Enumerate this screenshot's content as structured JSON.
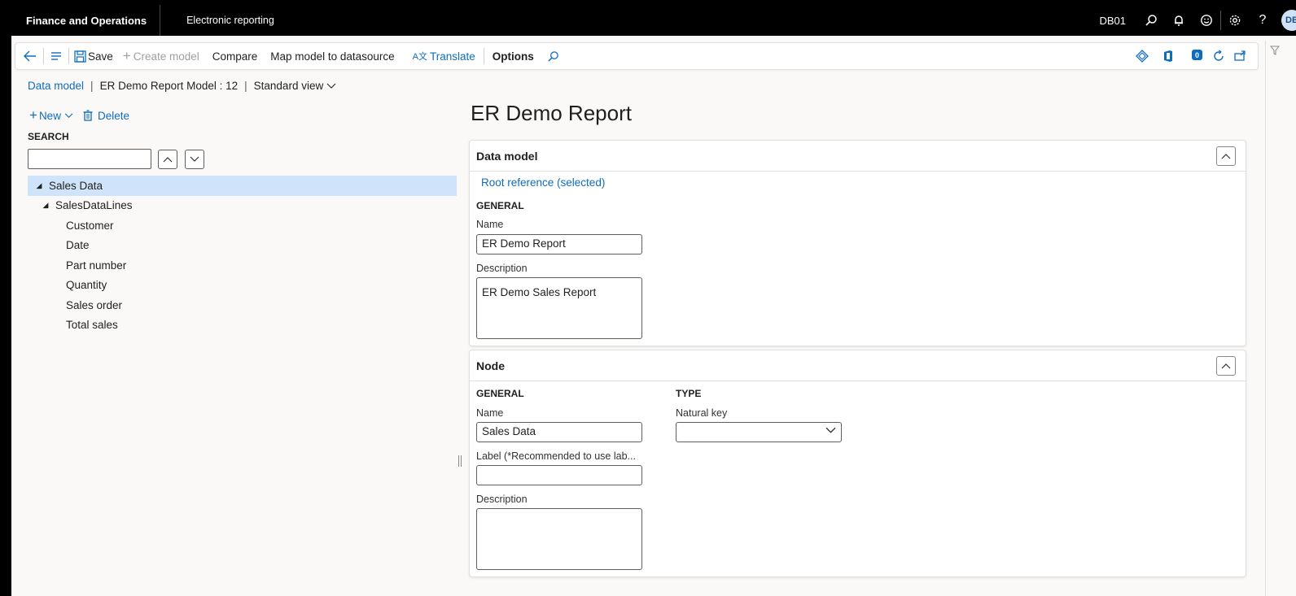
{
  "topbar": {
    "app_title": "Finance and Operations",
    "module_title": "Electronic reporting",
    "company": "DB01",
    "avatar_initials": "DB",
    "icons": [
      "search-icon",
      "bell-icon",
      "smiley-icon",
      "gear-icon",
      "help-icon"
    ]
  },
  "actionpane": {
    "save_label": "Save",
    "create_model_label": "Create model",
    "compare_label": "Compare",
    "map_label": "Map model to datasource",
    "translate_label": "Translate",
    "options_label": "Options",
    "notification_count": "0"
  },
  "breadcrumb": {
    "link": "Data model",
    "model": "ER Demo Report Model : 12",
    "view": "Standard view"
  },
  "left": {
    "new_label": "New",
    "delete_label": "Delete",
    "search_label": "SEARCH",
    "search_value": "",
    "tree": [
      {
        "label": "Sales Data",
        "caret": "◢",
        "indent": 0,
        "selected": true
      },
      {
        "label": "SalesDataLines",
        "caret": "◢",
        "indent": 1
      },
      {
        "label": "Customer",
        "indent": 2
      },
      {
        "label": "Date",
        "indent": 2
      },
      {
        "label": "Part number",
        "indent": 2
      },
      {
        "label": "Quantity",
        "indent": 2
      },
      {
        "label": "Sales order",
        "indent": 2
      },
      {
        "label": "Total sales",
        "indent": 2
      }
    ]
  },
  "main": {
    "title": "ER Demo Report",
    "data_model": {
      "header": "Data model",
      "root_link": "Root reference (selected)",
      "general_label": "GENERAL",
      "name_label": "Name",
      "name_value": "ER Demo Report",
      "description_label": "Description",
      "description_value": "ER Demo Sales Report"
    },
    "node": {
      "header": "Node",
      "general_label": "GENERAL",
      "name_label": "Name",
      "name_value": "Sales Data",
      "label_label": "Label (*Recommended to use lab...",
      "label_value": "",
      "description_label": "Description",
      "description_value": "",
      "type_label": "TYPE",
      "natural_key_label": "Natural key",
      "natural_key_value": ""
    }
  },
  "colors": {
    "accent": "#0f6cbd",
    "topbar_bg": "#000000",
    "selected_row": "#cfe4fa",
    "page_bg": "#faf9f8"
  }
}
